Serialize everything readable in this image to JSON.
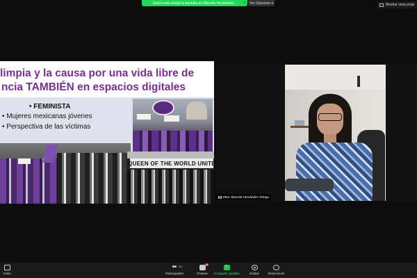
{
  "top_banner": {
    "text": "Usted está viendo la pantalla de Marcela Hernández...",
    "close_icon": "x"
  },
  "view_options": {
    "label": "Ver Opciones ▾"
  },
  "side_view": {
    "label": "Mostrar vista propi"
  },
  "slide": {
    "title_line1": "limpia y la causa por una vida libre de",
    "title_line2": "ncia TAMBIÉN en espacios digitales",
    "heading": "• FEMINISTA",
    "bullets": [
      "• Mujeres mexicanas jóvenes",
      "• Perspectiva de las víctimas"
    ],
    "photo_caption": "QUEEN OF THE WORLD UNITE"
  },
  "participant": {
    "name": "Mtra. Marcela Hernández Ortega"
  },
  "toolbar": {
    "video_label": "Video",
    "participants_label": "Participantes",
    "participants_count": "111",
    "chat_label": "Chatear",
    "chat_badge": "48",
    "share_label": "Compartir pantalla",
    "record_label": "Grabar",
    "reactions_label": "Reacciones"
  },
  "colors": {
    "accent_green": "#23d959",
    "slide_title": "#7b2e91",
    "share_green": "#27c14b"
  }
}
